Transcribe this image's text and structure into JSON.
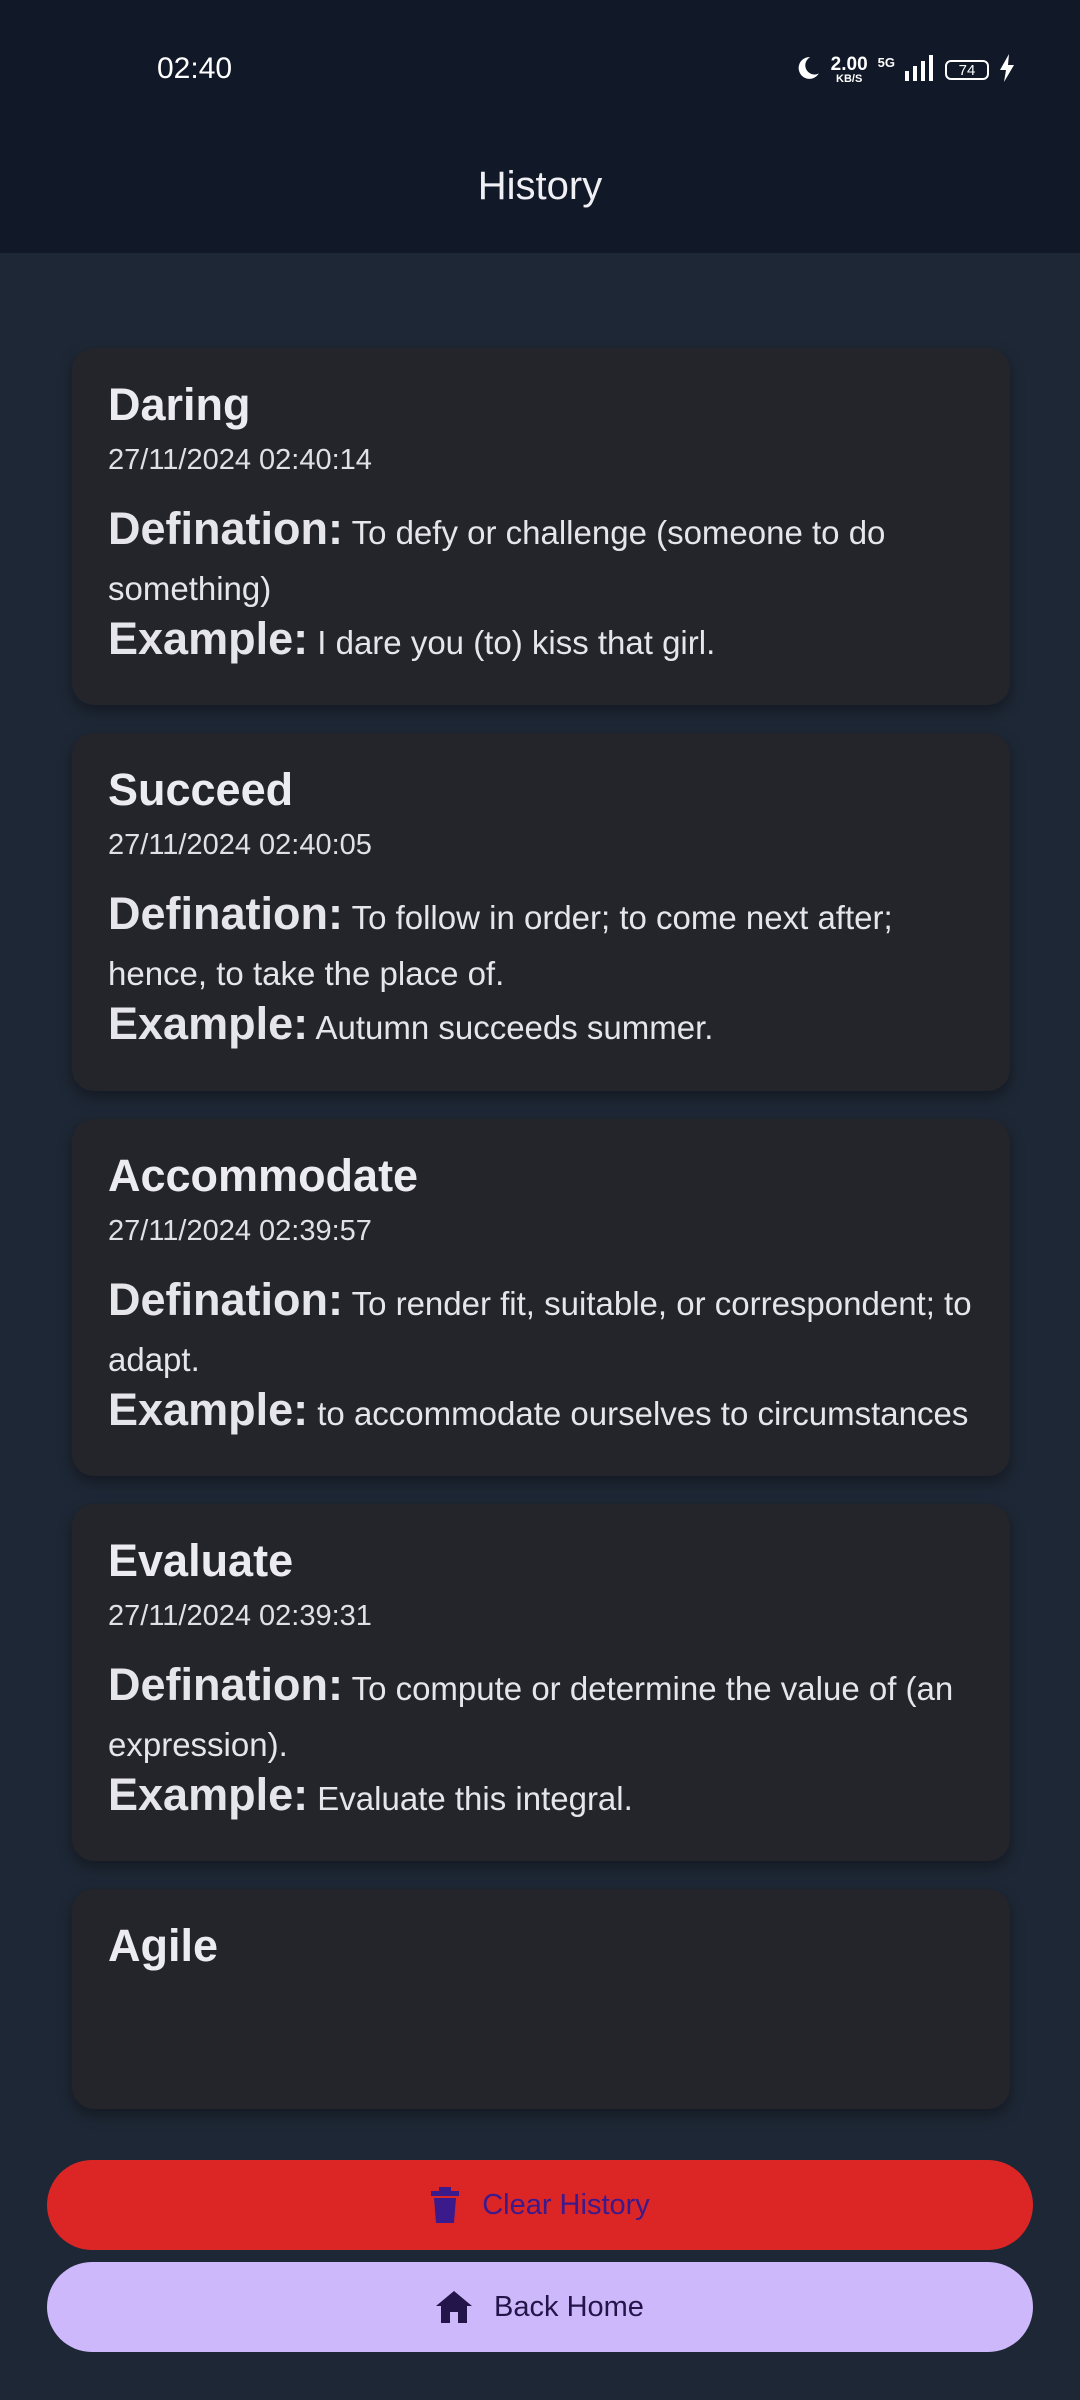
{
  "status_bar": {
    "time": "02:40",
    "speed_value": "2.00",
    "speed_unit": "KB/S",
    "network": "5G",
    "battery": "74",
    "icons": [
      "moon-icon",
      "signal-icon",
      "battery-icon",
      "charging-icon"
    ]
  },
  "appbar": {
    "title": "History"
  },
  "labels": {
    "definition": "Defination:",
    "example": "Example:"
  },
  "history": [
    {
      "word": "Daring",
      "date": "27/11/2024 02:40:14",
      "definition": "To defy or challenge (someone to do something)",
      "example": "I dare you (to) kiss that girl."
    },
    {
      "word": "Succeed",
      "date": "27/11/2024 02:40:05",
      "definition": "To follow in order; to come next after; hence, to take the place of.",
      "example": "Autumn succeeds summer."
    },
    {
      "word": "Accommodate",
      "date": "27/11/2024 02:39:57",
      "definition": "To render fit, suitable, or correspondent; to adapt.",
      "example": "to accommodate ourselves to circumstances"
    },
    {
      "word": "Evaluate",
      "date": "27/11/2024 02:39:31",
      "definition": "To compute or determine the value of (an expression).",
      "example": "Evaluate this integral."
    },
    {
      "word": "Agile"
    }
  ],
  "actions": {
    "clear_label": "Clear History",
    "home_label": "Back Home"
  },
  "colors": {
    "background": "#1e2735",
    "header": "#111827",
    "card": "#24242b",
    "clear_button": "#dc2626",
    "home_button": "#cdb8fb"
  }
}
